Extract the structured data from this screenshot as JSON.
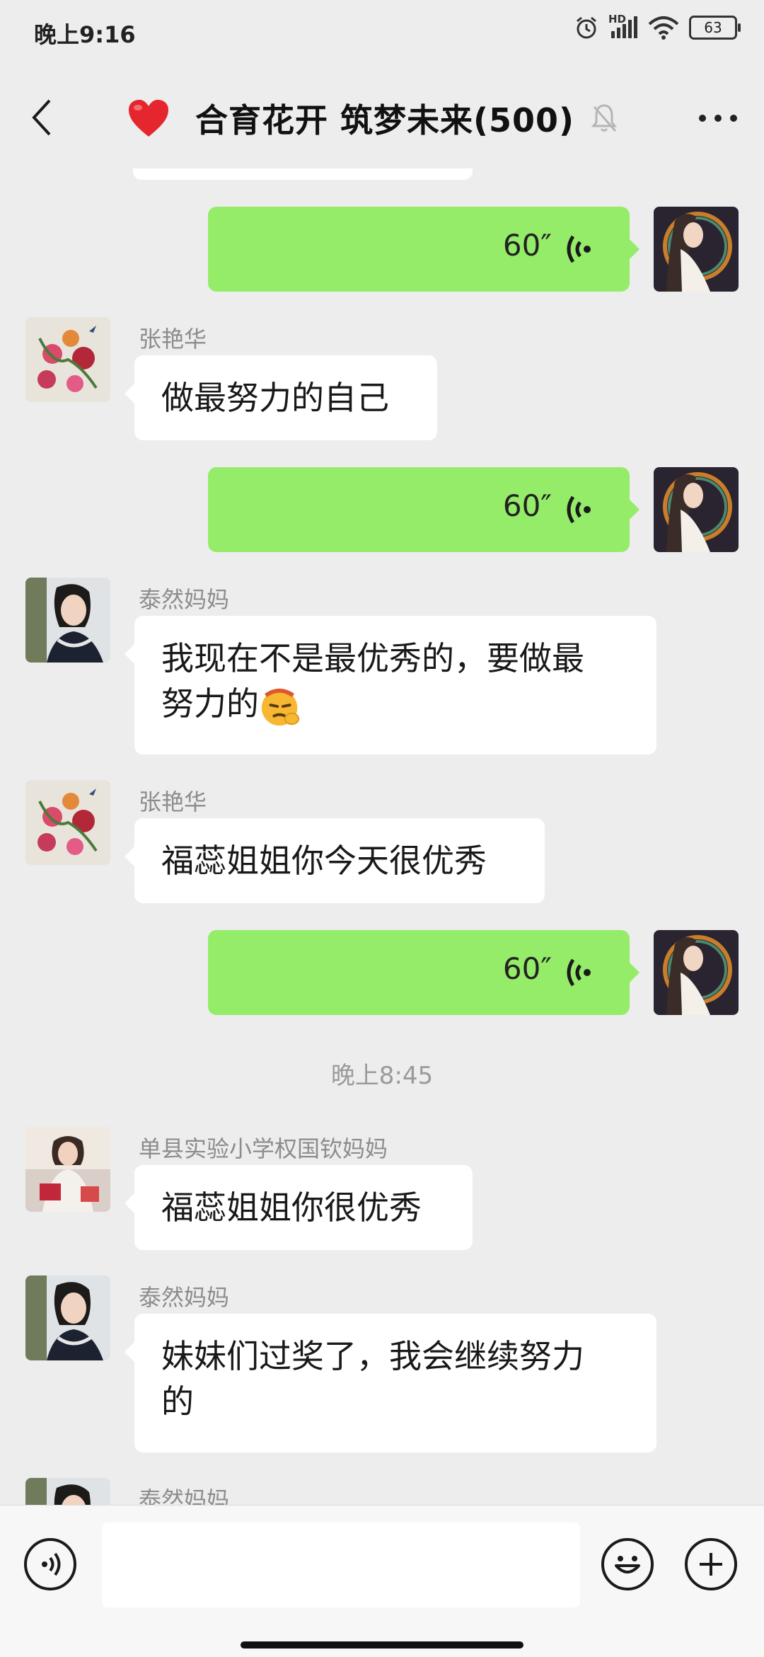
{
  "status_bar": {
    "time": "晚上9:16",
    "network": "HD",
    "battery": "63"
  },
  "header": {
    "title": "合育花开 筑梦未来(500)"
  },
  "messages": [
    {
      "type": "voice",
      "side": "right",
      "duration": "60″"
    },
    {
      "type": "text",
      "side": "left",
      "sender": "张艳华",
      "text": "做最努力的自己"
    },
    {
      "type": "voice",
      "side": "right",
      "duration": "60″"
    },
    {
      "type": "text",
      "side": "left",
      "sender": "泰然妈妈",
      "line1": "我现在不是最优秀的，要做最",
      "line2": "努力的"
    },
    {
      "type": "text",
      "side": "left",
      "sender": "张艳华",
      "text": "福蕊姐姐你今天很优秀"
    },
    {
      "type": "voice",
      "side": "right",
      "duration": "60″"
    },
    {
      "type": "time",
      "text": "晚上8:45"
    },
    {
      "type": "text",
      "side": "left",
      "sender": "单县实验小学权国钦妈妈",
      "text": "福蕊姐姐你很优秀"
    },
    {
      "type": "text",
      "side": "left",
      "sender": "泰然妈妈",
      "line1": "妹妹们过奖了，我会继续努力",
      "line2": "的"
    },
    {
      "type": "partial",
      "side": "left",
      "sender": "泰然妈妈"
    }
  ],
  "input": {
    "value": "",
    "placeholder": ""
  },
  "colors": {
    "background": "#ededed",
    "self_bubble": "#95ec69",
    "other_bubble": "#ffffff"
  }
}
